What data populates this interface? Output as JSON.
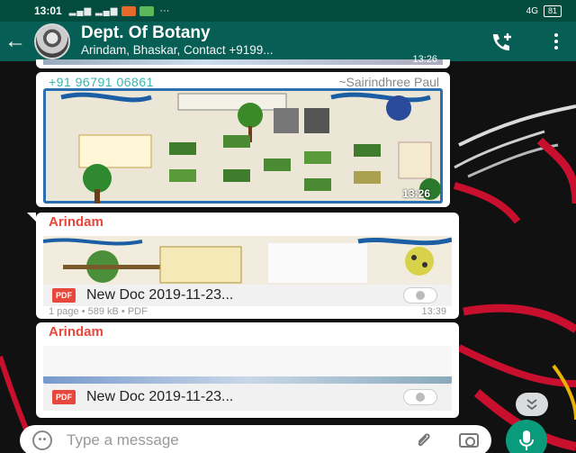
{
  "status": {
    "time": "13:01",
    "network": "4G",
    "battery": "81"
  },
  "header": {
    "title": "Dept. Of Botany",
    "subtitle": "Arindam, Bhaskar, Contact +9199..."
  },
  "messages": [
    {
      "time": "13:26"
    },
    {
      "sender_phone": "+91 96791 06861",
      "sender_alias": "~Sairindhree Paul",
      "time": "13:26"
    },
    {
      "sender": "Arindam",
      "doc_type": "PDF",
      "doc_name": "New Doc 2019-11-23...",
      "meta": "1 page • 589 kB • PDF",
      "time": "13:39"
    },
    {
      "sender": "Arindam",
      "doc_type": "PDF",
      "doc_name": "New Doc 2019-11-23..."
    }
  ],
  "composer": {
    "placeholder": "Type a message"
  },
  "colors": {
    "header": "#075e54",
    "status_bar": "#044c3e",
    "accent": "#0a9a7c",
    "sender_red": "#e8473c",
    "sender_teal": "#35b7b0"
  },
  "icons": [
    "back-arrow-icon",
    "add-call-icon",
    "more-options-icon",
    "pdf-icon",
    "download-icon",
    "emoji-icon",
    "attach-icon",
    "camera-icon",
    "mic-icon",
    "double-chevron-down-icon"
  ]
}
